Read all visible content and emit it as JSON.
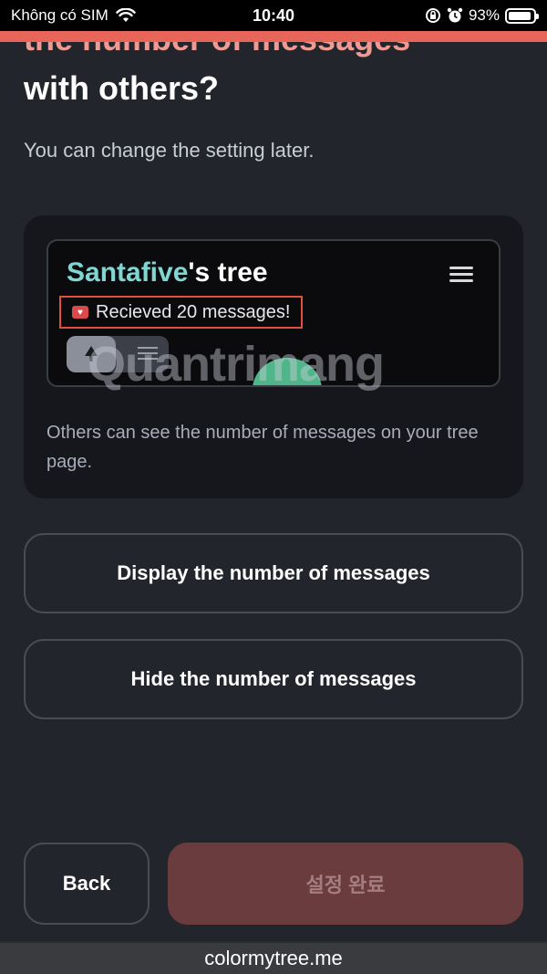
{
  "status_bar": {
    "carrier": "Không có SIM",
    "time": "10:40",
    "battery": "93%",
    "battery_level": 0.93,
    "icons": [
      "wifi-icon",
      "rotation-lock-icon",
      "alarm-icon",
      "battery-icon"
    ]
  },
  "colors": {
    "accent": "#e8655a",
    "background": "#23252c",
    "card": "#16171c",
    "done_button": "#6b3c3e",
    "tree_name": "#7fd6d3"
  },
  "heading": {
    "line1_cut": "the number of messages",
    "line2": "with others?"
  },
  "subtitle": "You can change the setting later.",
  "preview": {
    "tree_name": "Santafive",
    "tree_suffix": "'s tree",
    "messages_badge": "Recieved 20 messages!",
    "description": "Others can see the number of messages on your tree page.",
    "watermark": "Quantrimang"
  },
  "options": {
    "display": "Display the number of messages",
    "hide": "Hide the number of messages"
  },
  "buttons": {
    "back": "Back",
    "done": "설정 완료"
  },
  "url": "colormytree.me"
}
